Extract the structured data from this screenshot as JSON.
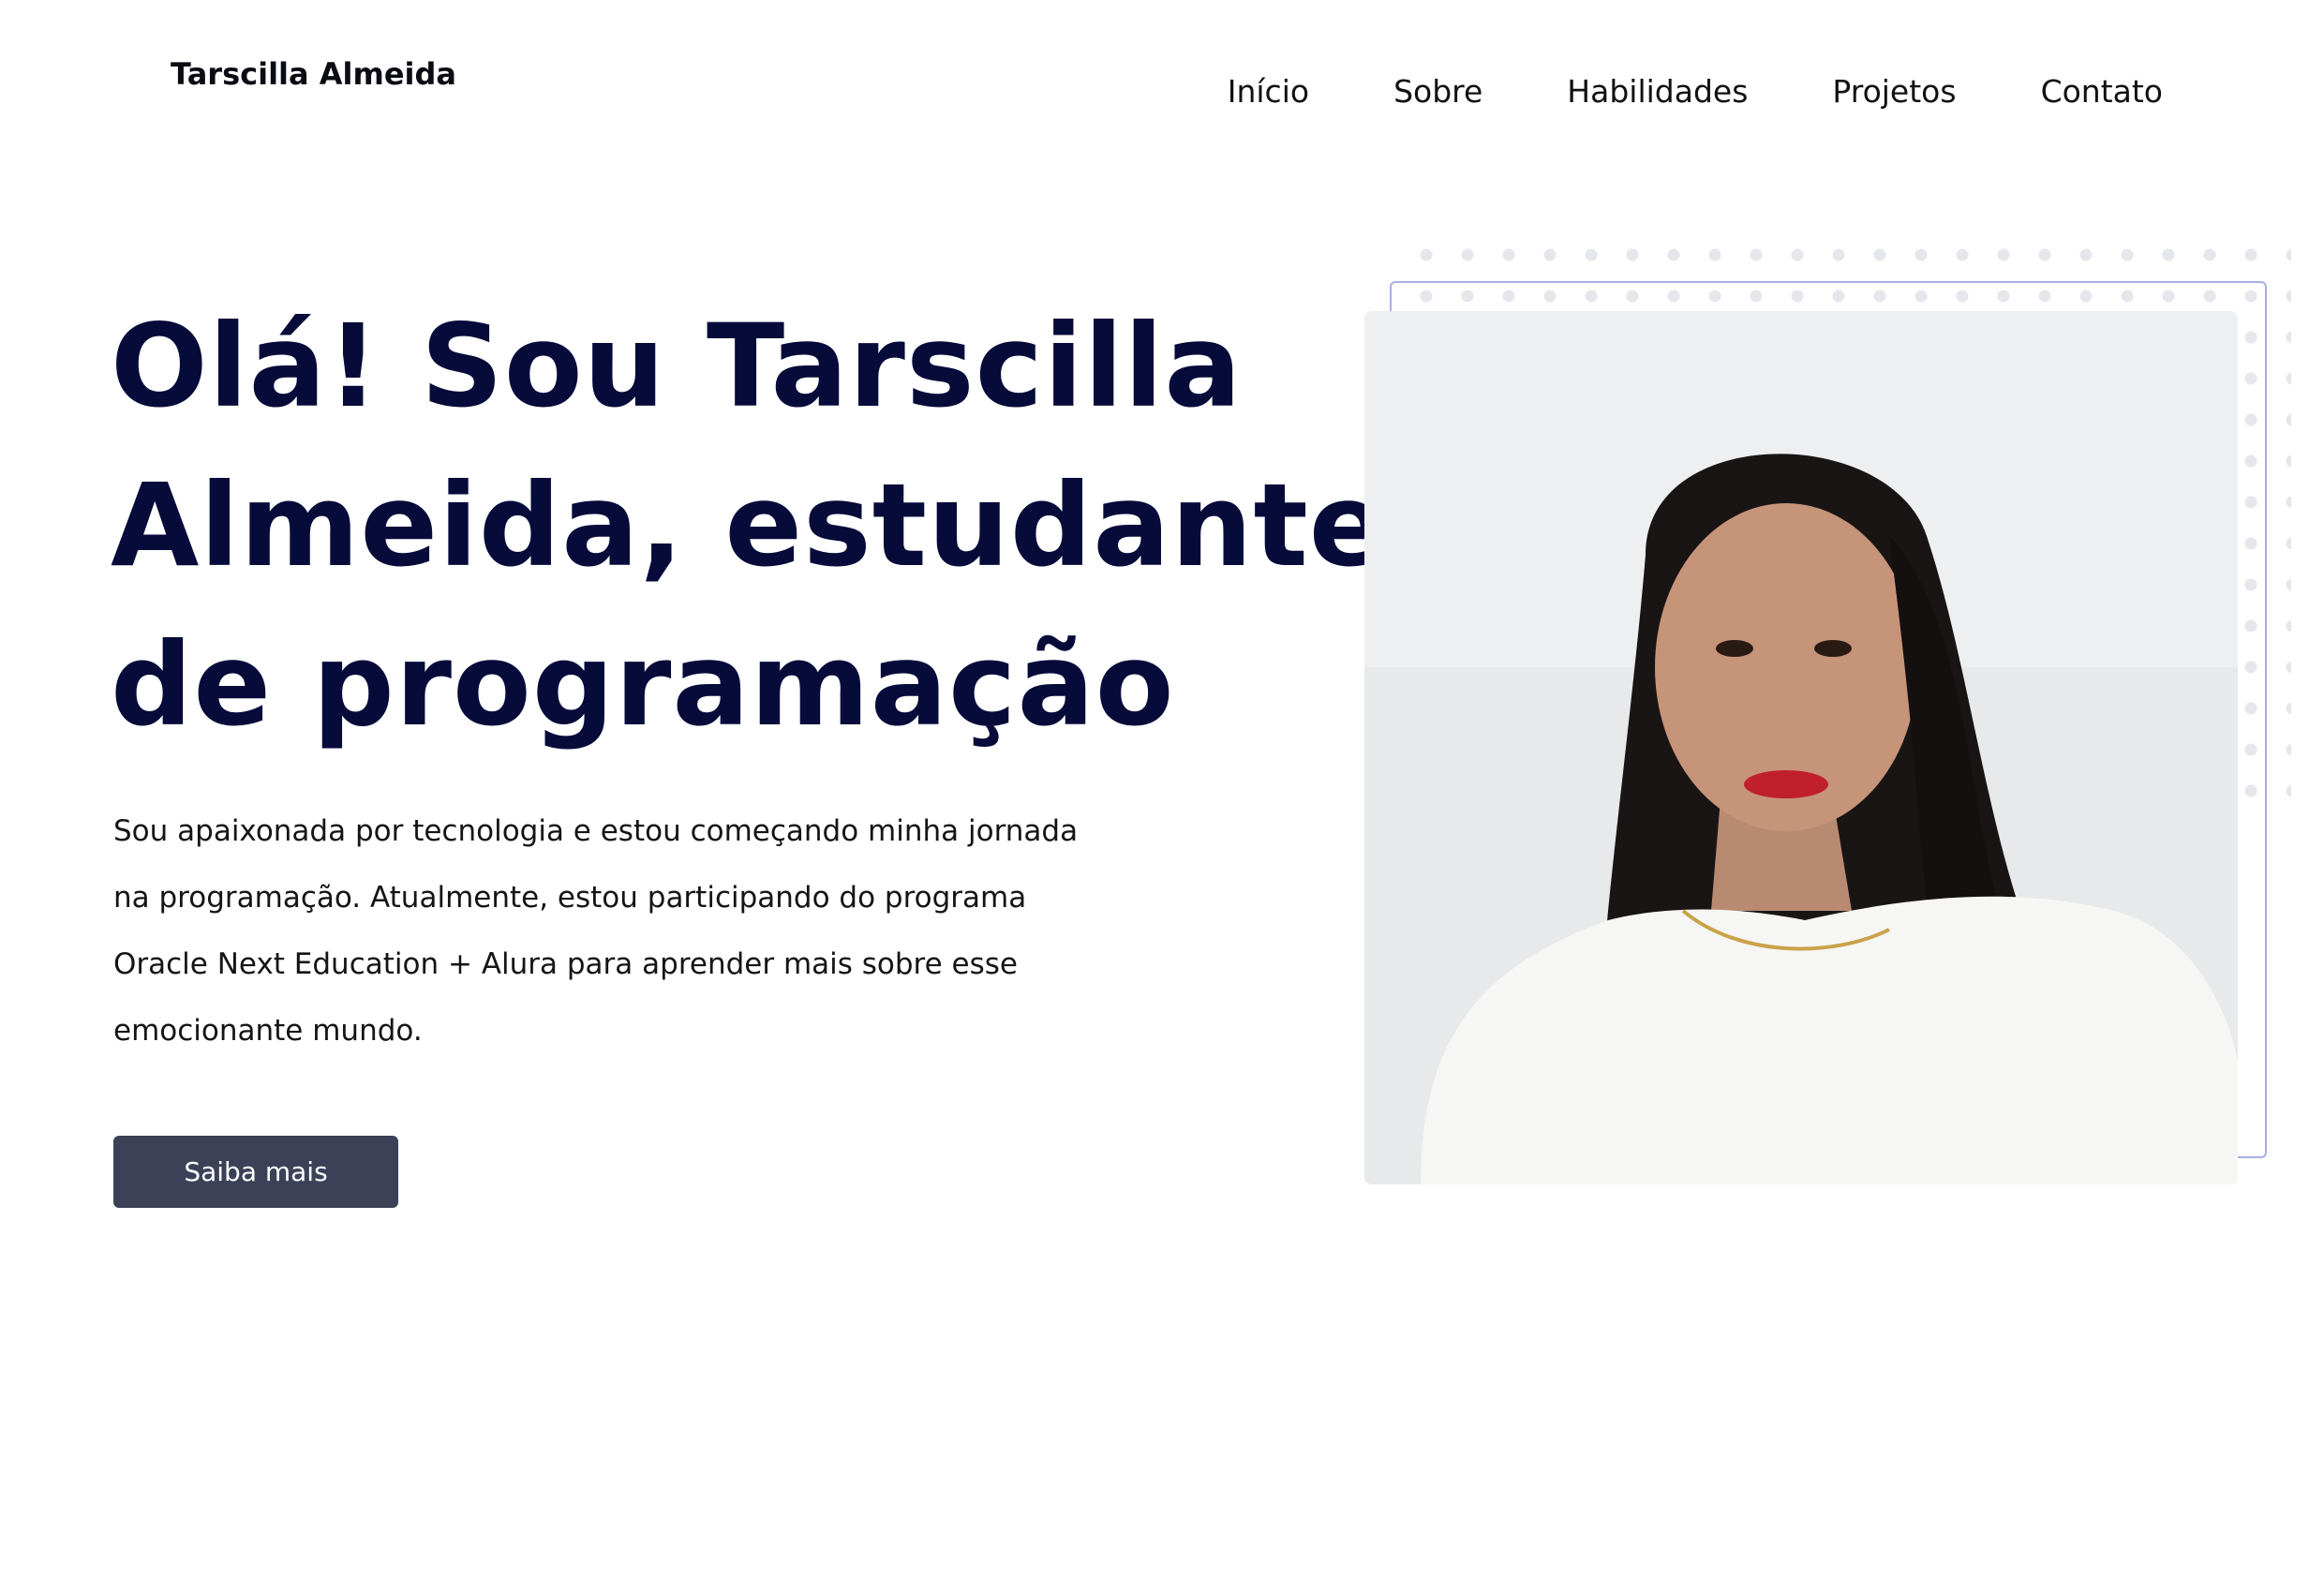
{
  "header": {
    "brand": "Tarscilla Almeida",
    "nav": [
      "Início",
      "Sobre",
      "Habilidades",
      "Projetos",
      "Contato"
    ]
  },
  "hero": {
    "title_lines": [
      "Olá! Sou Tarscilla",
      "Almeida, estudante",
      "de programação"
    ],
    "description_lines": [
      "Sou apaixonada por tecnologia e estou começando minha jornada",
      "na programação. Atualmente, estou participando do programa",
      "Oracle Next Education + Alura para aprender mais sobre esse",
      "emocionante mundo."
    ],
    "cta_label": "Saiba mais"
  },
  "colors": {
    "title": "#070b3a",
    "button": "#3c4157",
    "frame_border": "#a7b0e2",
    "dots": "#e6e7ec"
  },
  "icons": {
    "profile_photo": "portrait-photo"
  }
}
